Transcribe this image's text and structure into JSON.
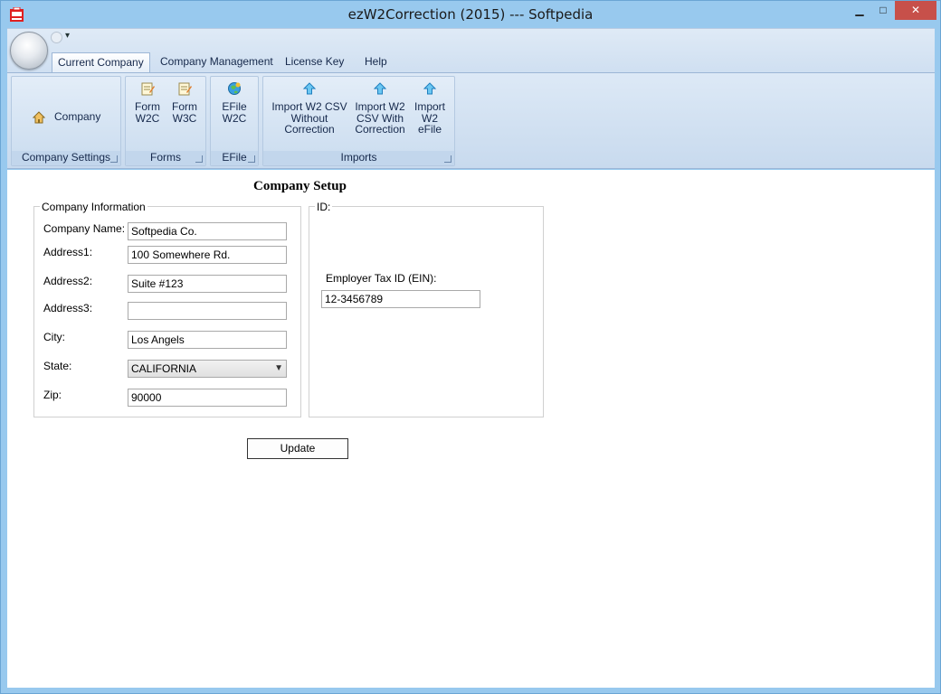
{
  "window": {
    "title": "ezW2Correction (2015) --- Softpedia",
    "minimize_glyph": "▁",
    "maximize_glyph": "□",
    "close_glyph": "✕"
  },
  "quick_access": {
    "dropdown_glyph": "▾"
  },
  "ribbon": {
    "tabs": [
      {
        "label": "Current Company",
        "active": true
      },
      {
        "label": "Company Management",
        "active": false
      },
      {
        "label": "License Key",
        "active": false
      },
      {
        "label": "Help",
        "active": false
      }
    ],
    "groups": {
      "company_settings": {
        "label": "Company Settings",
        "buttons": [
          {
            "label": "Company",
            "icon": "house-icon"
          }
        ]
      },
      "forms": {
        "label": "Forms",
        "buttons": [
          {
            "label": "Form\nW2C",
            "icon": "form-edit-icon"
          },
          {
            "label": "Form\nW3C",
            "icon": "form-edit-icon"
          }
        ]
      },
      "efile": {
        "label": "EFile",
        "buttons": [
          {
            "label": "EFile\nW2C",
            "icon": "globe-icon"
          }
        ]
      },
      "imports": {
        "label": "Imports",
        "buttons": [
          {
            "label": "Import W2 CSV\nWithout\nCorrection",
            "icon": "up-arrow-icon"
          },
          {
            "label": "Import W2\nCSV With\nCorrection",
            "icon": "up-arrow-icon"
          },
          {
            "label": "Import\nW2\neFile",
            "icon": "up-arrow-icon"
          }
        ]
      }
    },
    "colors": {
      "accent": "#15284b",
      "icon_blue": "#3aa7e0"
    }
  },
  "page": {
    "heading": "Company Setup",
    "company_info": {
      "legend": "Company Information",
      "fields": {
        "company_name": {
          "label": "Company Name:",
          "value": "Softpedia Co."
        },
        "address1": {
          "label": "Address1:",
          "value": "100 Somewhere Rd."
        },
        "address2": {
          "label": "Address2:",
          "value": "Suite #123"
        },
        "address3": {
          "label": "Address3:",
          "value": ""
        },
        "city": {
          "label": "City:",
          "value": "Los Angels"
        },
        "state": {
          "label": "State:",
          "value": "CALIFORNIA"
        },
        "zip": {
          "label": "Zip:",
          "value": "90000"
        }
      }
    },
    "id_box": {
      "legend": "ID:",
      "ein_label": "Employer Tax ID (EIN):",
      "ein_value": "12-3456789"
    },
    "update_label": "Update"
  }
}
